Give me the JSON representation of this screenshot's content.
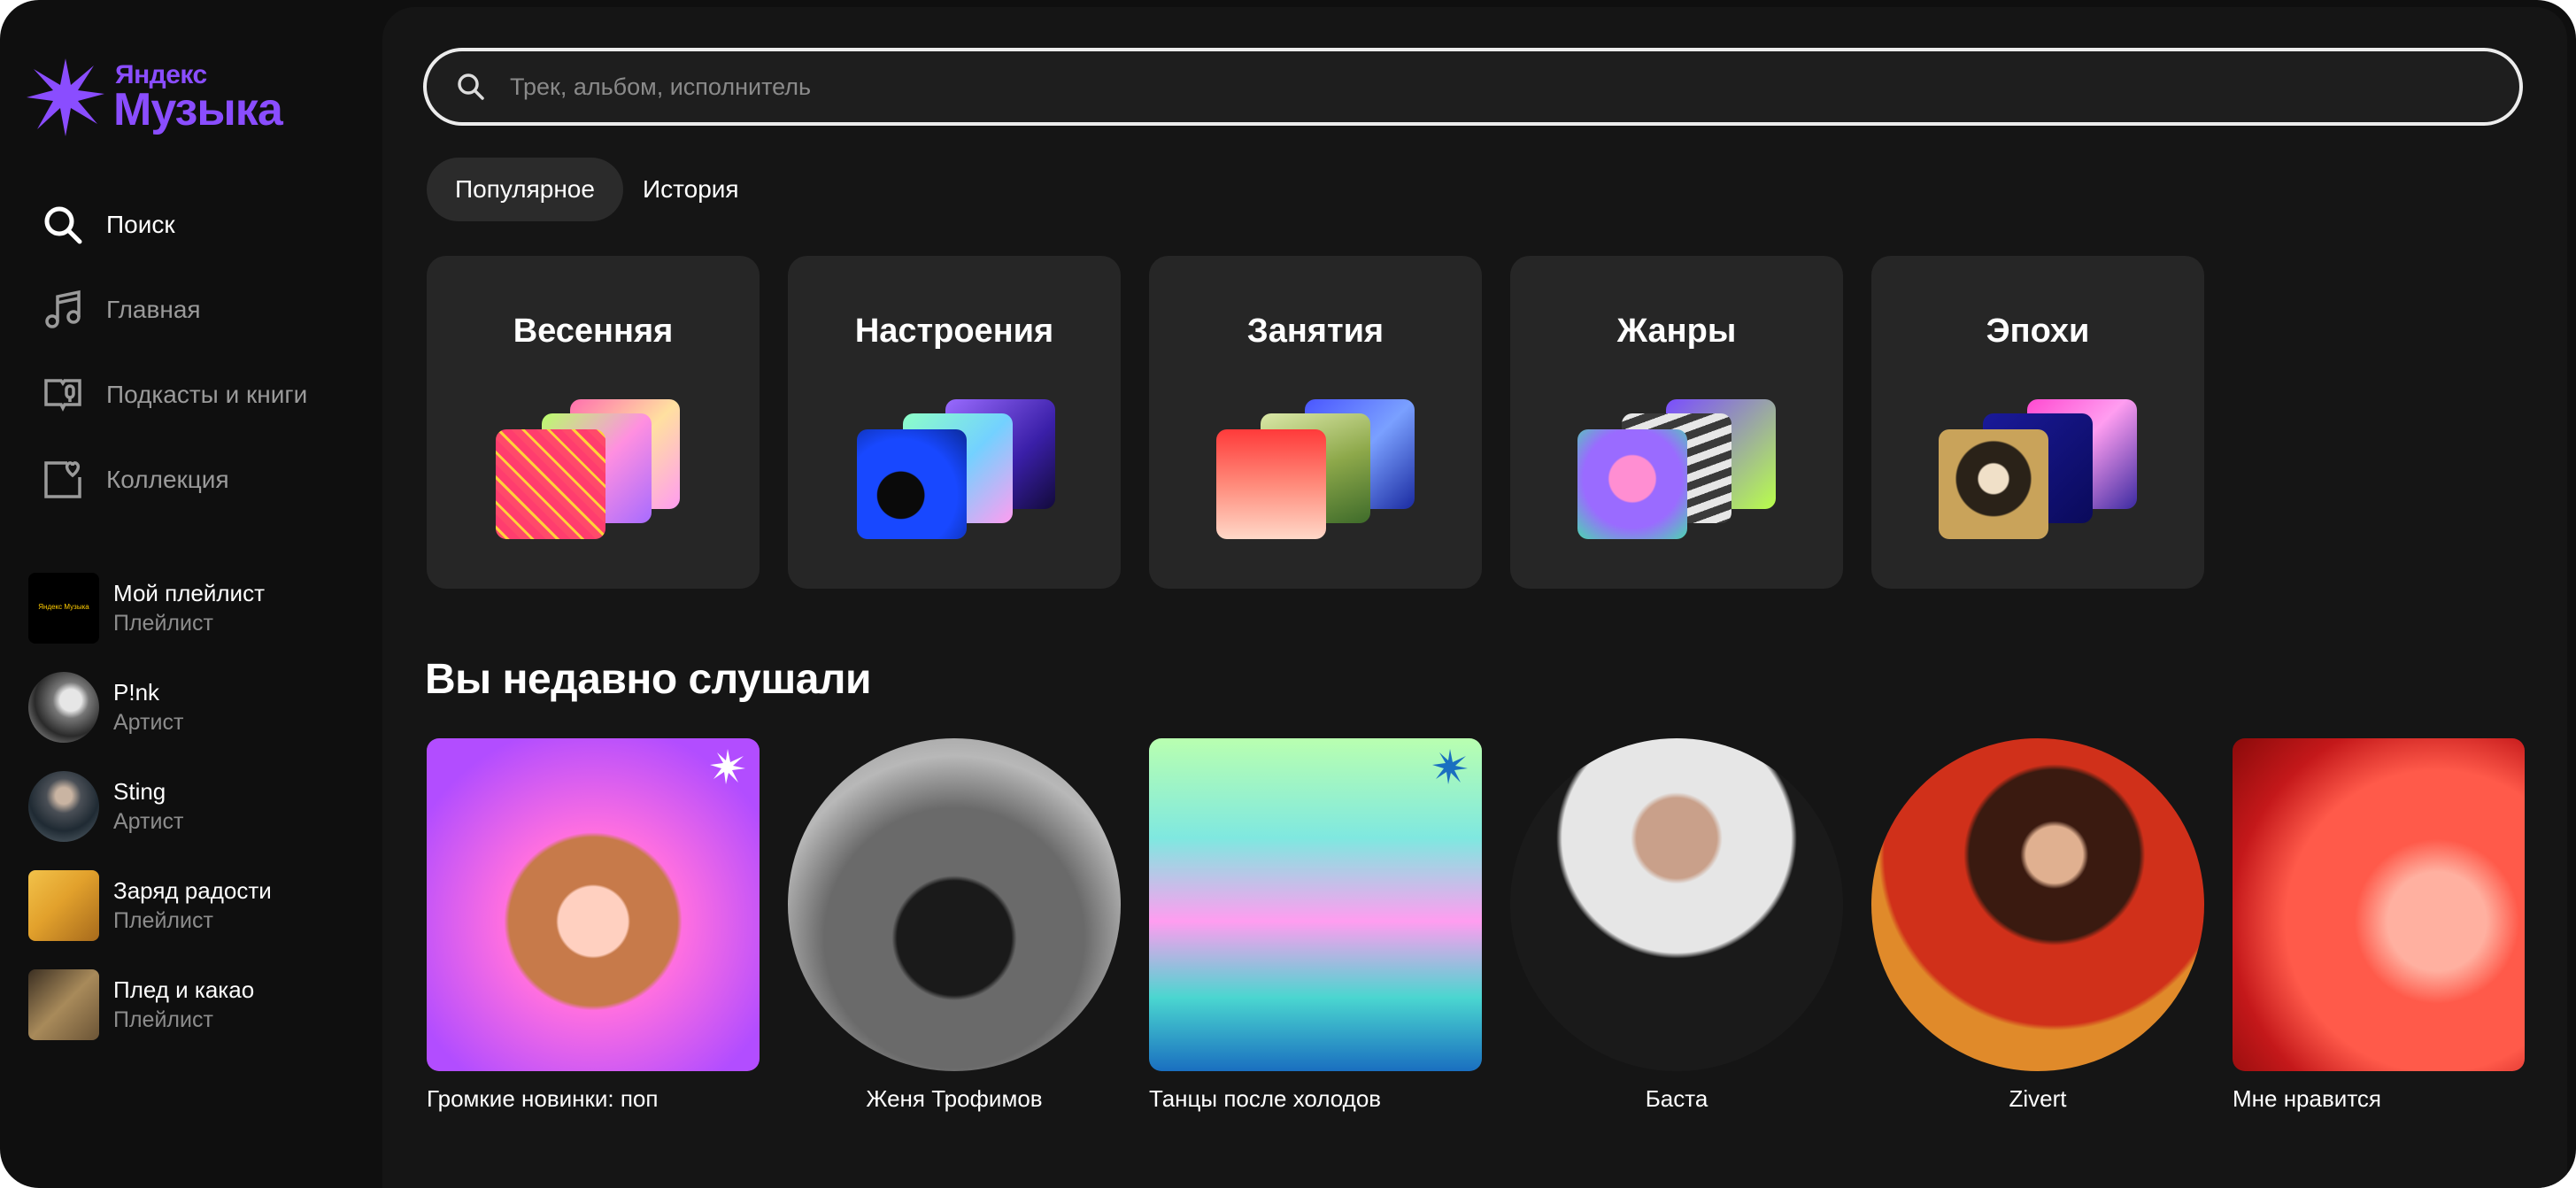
{
  "brand": {
    "line1": "Яндекс",
    "line2": "Музыка",
    "color": "#8a4dff"
  },
  "nav": [
    {
      "label": "Поиск",
      "icon": "search-icon",
      "active": true
    },
    {
      "label": "Главная",
      "icon": "music-note-icon",
      "active": false
    },
    {
      "label": "Подкасты и книги",
      "icon": "podcast-book-icon",
      "active": false
    },
    {
      "label": "Коллекция",
      "icon": "collection-heart-icon",
      "active": false
    }
  ],
  "library": [
    {
      "title": "Мой плейлист",
      "subtitle": "Плейлист",
      "thumb_text": "Яндекс Музыка"
    },
    {
      "title": "P!nk",
      "subtitle": "Артист"
    },
    {
      "title": "Sting",
      "subtitle": "Артист"
    },
    {
      "title": "Заряд радости",
      "subtitle": "Плейлист"
    },
    {
      "title": "Плед и какао",
      "subtitle": "Плейлист"
    }
  ],
  "search": {
    "placeholder": "Трек, альбом, исполнитель",
    "value": ""
  },
  "tabs": [
    {
      "label": "Популярное",
      "active": true
    },
    {
      "label": "История",
      "active": false
    }
  ],
  "categories": [
    {
      "title": "Весенняя"
    },
    {
      "title": "Настроения"
    },
    {
      "title": "Занятия"
    },
    {
      "title": "Жанры"
    },
    {
      "title": "Эпохи"
    }
  ],
  "recent": {
    "title": "Вы недавно слушали",
    "items": [
      {
        "label": "Громкие новинки: поп",
        "shape": "square"
      },
      {
        "label": "Женя Трофимов",
        "shape": "round"
      },
      {
        "label": "Танцы после холодов",
        "shape": "square"
      },
      {
        "label": "Баста",
        "shape": "round"
      },
      {
        "label": "Zivert",
        "shape": "round"
      },
      {
        "label": "Мне нравится",
        "shape": "square"
      }
    ]
  }
}
